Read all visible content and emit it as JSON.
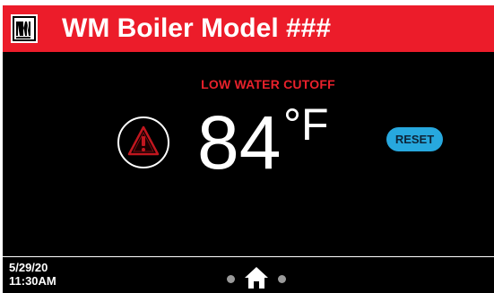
{
  "header": {
    "logo_text": "WM",
    "title": "WM Boiler Model ###",
    "background_color": "#ec1c2a"
  },
  "alert": {
    "message": "LOW WATER CUTOFF",
    "icon": "warning-icon",
    "color": "#e8212b"
  },
  "temperature": {
    "value": "84",
    "unit": "°F"
  },
  "reset_button": {
    "label": "RESET",
    "color": "#27a8de"
  },
  "footer": {
    "date": "5/29/20",
    "time": "11:30AM",
    "nav_icon": "home-icon",
    "page_count": 3,
    "current_page": 2
  }
}
